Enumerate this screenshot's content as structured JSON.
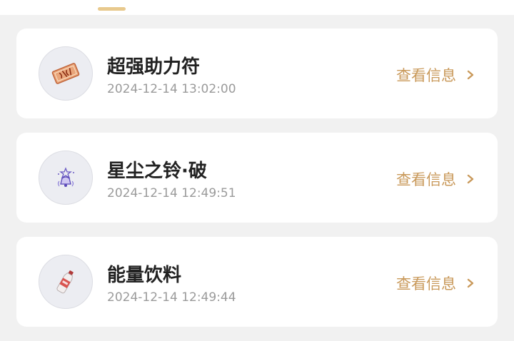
{
  "items": [
    {
      "name": "超强助力符",
      "time": "2024-12-14 13:02:00",
      "action_label": "查看信息",
      "icon": "talisman-icon"
    },
    {
      "name": "星尘之铃·破",
      "time": "2024-12-14 12:49:51",
      "action_label": "查看信息",
      "icon": "stardust-bell-icon"
    },
    {
      "name": "能量饮料",
      "time": "2024-12-14 12:49:44",
      "action_label": "查看信息",
      "icon": "energy-drink-icon"
    }
  ],
  "colors": {
    "accent": "#c9995a",
    "tab_indicator": "#e8c98d",
    "title": "#222222",
    "time": "#9a9a9a",
    "background": "#f1f1f1"
  }
}
